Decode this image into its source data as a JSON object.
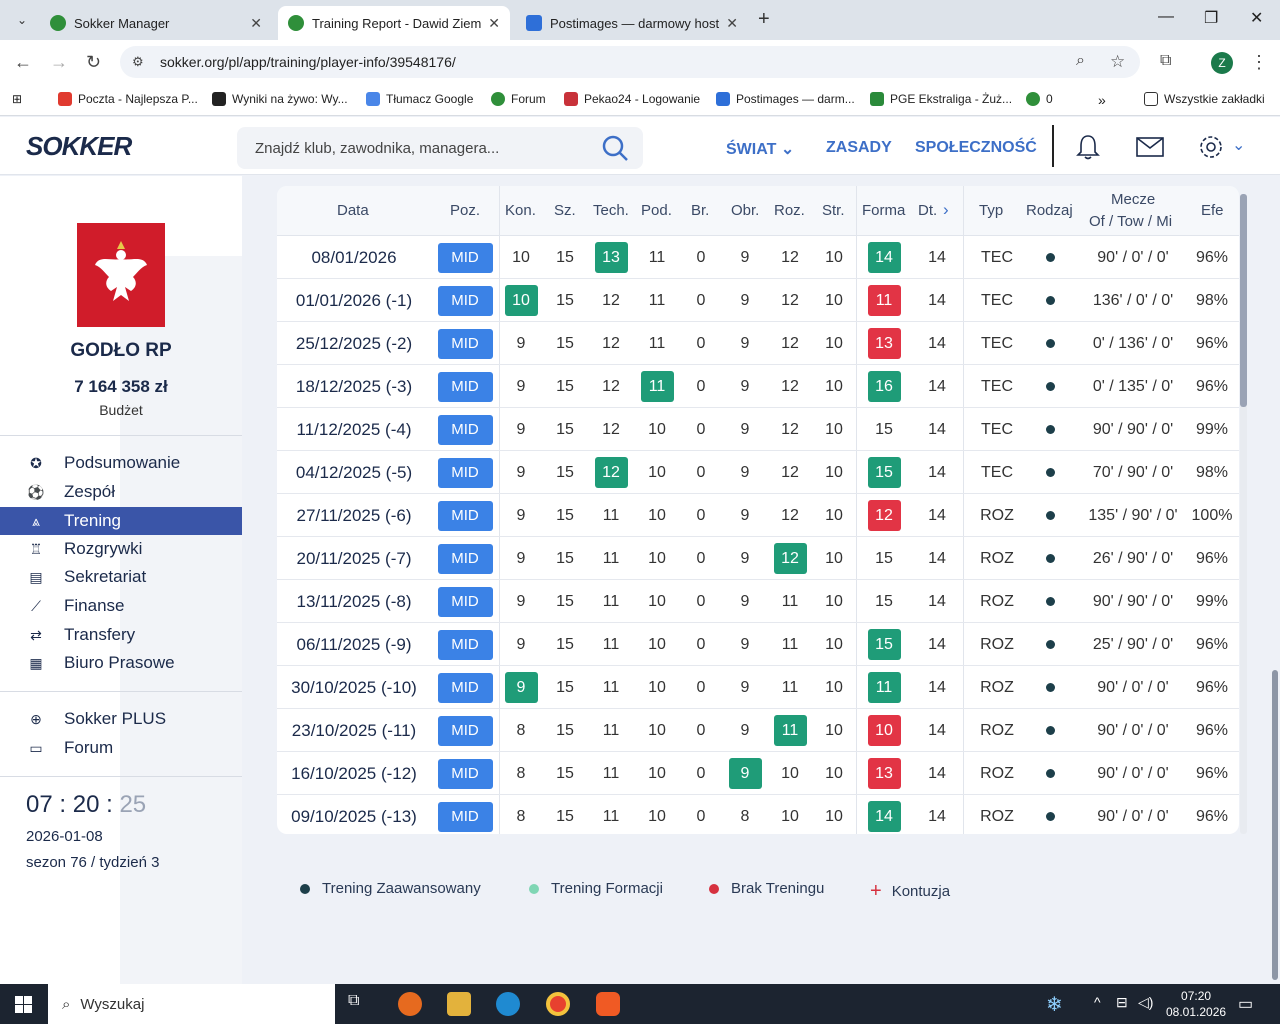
{
  "browser": {
    "tabs": [
      {
        "title": "Sokker Manager",
        "active": false
      },
      {
        "title": "Training Report - Dawid Ziemia",
        "active": true
      },
      {
        "title": "Postimages — darmowy hostin",
        "active": false
      }
    ],
    "url": "sokker.org/pl/app/training/player-info/39548176/",
    "profile_initial": "Z",
    "bookmarks": [
      "Poczta - Najlepsza P...",
      "Wyniki na żywo: Wy...",
      "Tłumacz Google",
      "Forum",
      "Pekao24 - Logowanie",
      "Postimages — darm...",
      "PGE Ekstraliga - Żuż...",
      "0"
    ],
    "bookmarks_overflow": "»",
    "all_bookmarks": "Wszystkie zakładki"
  },
  "site": {
    "logo": "SOKKER",
    "search_placeholder": "Znajdź klub, zawodnika, managera...",
    "nav": [
      "ŚWIAT",
      "ZASADY",
      "SPOŁECZNOŚĆ"
    ]
  },
  "sidebar": {
    "club_name": "GODŁO RP",
    "budget_value": "7 164 358 zł",
    "budget_label": "Budżet",
    "menu": [
      {
        "label": "Podsumowanie",
        "icon": "medal-icon",
        "active": false
      },
      {
        "label": "Zespół",
        "icon": "ball-icon",
        "active": false
      },
      {
        "label": "Trening",
        "icon": "cone-icon",
        "active": true
      },
      {
        "label": "Rozgrywki",
        "icon": "trophy-icon",
        "active": false
      },
      {
        "label": "Sekretariat",
        "icon": "briefcase-icon",
        "active": false
      },
      {
        "label": "Finanse",
        "icon": "chart-icon",
        "active": false
      },
      {
        "label": "Transfery",
        "icon": "arrows-icon",
        "active": false
      },
      {
        "label": "Biuro Prasowe",
        "icon": "newspaper-icon",
        "active": false
      }
    ],
    "extra": [
      {
        "label": "Sokker PLUS",
        "icon": "plus-circle-icon"
      },
      {
        "label": "Forum",
        "icon": "chat-icon"
      }
    ],
    "clock_h": "07",
    "clock_m": "20",
    "clock_s": "25",
    "date": "2026-01-08",
    "season": "sezon 76 / tydzień 3"
  },
  "table": {
    "headers": {
      "data": "Data",
      "poz": "Poz.",
      "kon": "Kon.",
      "sz": "Sz.",
      "tech": "Tech.",
      "pod": "Pod.",
      "br": "Br.",
      "obr": "Obr.",
      "roz": "Roz.",
      "str": "Str.",
      "forma": "Forma",
      "dt": "Dt.",
      "typ": "Typ",
      "rodzaj": "Rodzaj",
      "mecze1": "Mecze",
      "mecze2": "Of / Tow / Mi",
      "efe": "Efe"
    },
    "rows": [
      {
        "date": "08/01/2026",
        "pos": "MID",
        "kon": "10",
        "sz": "15",
        "tech": "13",
        "pod": "11",
        "br": "0",
        "obr": "9",
        "roz": "12",
        "str": "10",
        "forma": "14",
        "dt": "14",
        "typ": "TEC",
        "mecze": "90' / 0' / 0'",
        "efe": "96%",
        "hl": {
          "tech": "g",
          "forma": "g"
        }
      },
      {
        "date": "01/01/2026 (-1)",
        "pos": "MID",
        "kon": "10",
        "sz": "15",
        "tech": "12",
        "pod": "11",
        "br": "0",
        "obr": "9",
        "roz": "12",
        "str": "10",
        "forma": "11",
        "dt": "14",
        "typ": "TEC",
        "mecze": "136' / 0' / 0'",
        "efe": "98%",
        "hl": {
          "kon": "g",
          "forma": "r"
        }
      },
      {
        "date": "25/12/2025 (-2)",
        "pos": "MID",
        "kon": "9",
        "sz": "15",
        "tech": "12",
        "pod": "11",
        "br": "0",
        "obr": "9",
        "roz": "12",
        "str": "10",
        "forma": "13",
        "dt": "14",
        "typ": "TEC",
        "mecze": "0' / 136' / 0'",
        "efe": "96%",
        "hl": {
          "forma": "r"
        }
      },
      {
        "date": "18/12/2025 (-3)",
        "pos": "MID",
        "kon": "9",
        "sz": "15",
        "tech": "12",
        "pod": "11",
        "br": "0",
        "obr": "9",
        "roz": "12",
        "str": "10",
        "forma": "16",
        "dt": "14",
        "typ": "TEC",
        "mecze": "0' / 135' / 0'",
        "efe": "96%",
        "hl": {
          "pod": "g",
          "forma": "g"
        }
      },
      {
        "date": "11/12/2025 (-4)",
        "pos": "MID",
        "kon": "9",
        "sz": "15",
        "tech": "12",
        "pod": "10",
        "br": "0",
        "obr": "9",
        "roz": "12",
        "str": "10",
        "forma": "15",
        "dt": "14",
        "typ": "TEC",
        "mecze": "90' / 90' / 0'",
        "efe": "99%",
        "hl": {}
      },
      {
        "date": "04/12/2025 (-5)",
        "pos": "MID",
        "kon": "9",
        "sz": "15",
        "tech": "12",
        "pod": "10",
        "br": "0",
        "obr": "9",
        "roz": "12",
        "str": "10",
        "forma": "15",
        "dt": "14",
        "typ": "TEC",
        "mecze": "70' / 90' / 0'",
        "efe": "98%",
        "hl": {
          "tech": "g",
          "forma": "g"
        }
      },
      {
        "date": "27/11/2025 (-6)",
        "pos": "MID",
        "kon": "9",
        "sz": "15",
        "tech": "11",
        "pod": "10",
        "br": "0",
        "obr": "9",
        "roz": "12",
        "str": "10",
        "forma": "12",
        "dt": "14",
        "typ": "ROZ",
        "mecze": "135' / 90' / 0'",
        "efe": "100%",
        "hl": {
          "forma": "r"
        }
      },
      {
        "date": "20/11/2025 (-7)",
        "pos": "MID",
        "kon": "9",
        "sz": "15",
        "tech": "11",
        "pod": "10",
        "br": "0",
        "obr": "9",
        "roz": "12",
        "str": "10",
        "forma": "15",
        "dt": "14",
        "typ": "ROZ",
        "mecze": "26' / 90' / 0'",
        "efe": "96%",
        "hl": {
          "roz": "g"
        }
      },
      {
        "date": "13/11/2025 (-8)",
        "pos": "MID",
        "kon": "9",
        "sz": "15",
        "tech": "11",
        "pod": "10",
        "br": "0",
        "obr": "9",
        "roz": "11",
        "str": "10",
        "forma": "15",
        "dt": "14",
        "typ": "ROZ",
        "mecze": "90' / 90' / 0'",
        "efe": "99%",
        "hl": {}
      },
      {
        "date": "06/11/2025 (-9)",
        "pos": "MID",
        "kon": "9",
        "sz": "15",
        "tech": "11",
        "pod": "10",
        "br": "0",
        "obr": "9",
        "roz": "11",
        "str": "10",
        "forma": "15",
        "dt": "14",
        "typ": "ROZ",
        "mecze": "25' / 90' / 0'",
        "efe": "96%",
        "hl": {
          "forma": "g"
        }
      },
      {
        "date": "30/10/2025 (-10)",
        "pos": "MID",
        "kon": "9",
        "sz": "15",
        "tech": "11",
        "pod": "10",
        "br": "0",
        "obr": "9",
        "roz": "11",
        "str": "10",
        "forma": "11",
        "dt": "14",
        "typ": "ROZ",
        "mecze": "90' / 0' / 0'",
        "efe": "96%",
        "hl": {
          "kon": "g",
          "forma": "g"
        }
      },
      {
        "date": "23/10/2025 (-11)",
        "pos": "MID",
        "kon": "8",
        "sz": "15",
        "tech": "11",
        "pod": "10",
        "br": "0",
        "obr": "9",
        "roz": "11",
        "str": "10",
        "forma": "10",
        "dt": "14",
        "typ": "ROZ",
        "mecze": "90' / 0' / 0'",
        "efe": "96%",
        "hl": {
          "roz": "g",
          "forma": "r"
        }
      },
      {
        "date": "16/10/2025 (-12)",
        "pos": "MID",
        "kon": "8",
        "sz": "15",
        "tech": "11",
        "pod": "10",
        "br": "0",
        "obr": "9",
        "roz": "10",
        "str": "10",
        "forma": "13",
        "dt": "14",
        "typ": "ROZ",
        "mecze": "90' / 0' / 0'",
        "efe": "96%",
        "hl": {
          "obr": "g",
          "forma": "r"
        }
      },
      {
        "date": "09/10/2025 (-13)",
        "pos": "MID",
        "kon": "8",
        "sz": "15",
        "tech": "11",
        "pod": "10",
        "br": "0",
        "obr": "8",
        "roz": "10",
        "str": "10",
        "forma": "14",
        "dt": "14",
        "typ": "ROZ",
        "mecze": "90' / 0' / 0'",
        "efe": "96%",
        "hl": {
          "forma": "g"
        }
      }
    ]
  },
  "legend": [
    {
      "label": "Trening Zaawansowany",
      "color": "#1d3f4a",
      "kind": "dot"
    },
    {
      "label": "Trening Formacji",
      "color": "#7fd6b4",
      "kind": "dot"
    },
    {
      "label": "Brak Treningu",
      "color": "#d6313f",
      "kind": "dot"
    },
    {
      "label": "Kontuzja",
      "color": "#d6313f",
      "kind": "plus"
    }
  ],
  "taskbar": {
    "search_placeholder": "Wyszukaj",
    "time": "07:20",
    "date": "08.01.2026"
  },
  "colors": {
    "accent": "#3d6fc7",
    "active_menu": "#3a55a8",
    "pill": "#3b82e6",
    "green": "#1f9c78",
    "red": "#e23445"
  }
}
